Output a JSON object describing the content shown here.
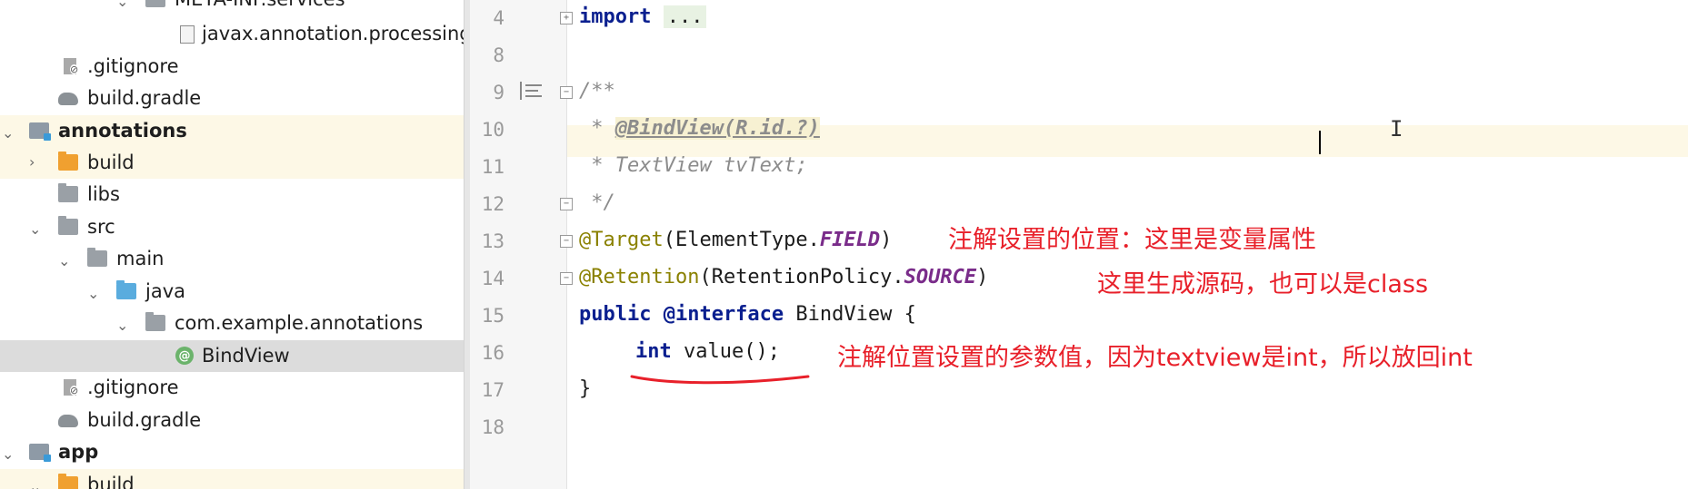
{
  "project_tree": {
    "items": [
      {
        "label": "META-INF.services",
        "icon": "folder-icon"
      },
      {
        "label": "javax.annotation.processing.",
        "icon": "file-icon"
      },
      {
        "label": ".gitignore",
        "icon": "gitignore-icon"
      },
      {
        "label": "build.gradle",
        "icon": "gradle-icon"
      },
      {
        "label": "annotations",
        "icon": "module-icon"
      },
      {
        "label": "build",
        "icon": "folder-icon"
      },
      {
        "label": "libs",
        "icon": "folder-icon"
      },
      {
        "label": "src",
        "icon": "folder-icon"
      },
      {
        "label": "main",
        "icon": "folder-icon"
      },
      {
        "label": "java",
        "icon": "source-folder-icon"
      },
      {
        "label": "com.example.annotations",
        "icon": "package-icon"
      },
      {
        "label": "BindView",
        "icon": "annotation-icon",
        "glyph": "@"
      },
      {
        "label": ".gitignore",
        "icon": "gitignore-icon"
      },
      {
        "label": "build.gradle",
        "icon": "gradle-icon"
      },
      {
        "label": "app",
        "icon": "module-icon"
      },
      {
        "label": "build",
        "icon": "folder-icon"
      }
    ]
  },
  "editor": {
    "line_numbers": [
      "4",
      "8",
      "9",
      "10",
      "11",
      "12",
      "13",
      "14",
      "15",
      "16",
      "17",
      "18"
    ],
    "code": {
      "l4_kw": "import",
      "l4_fold": "...",
      "l9": "/**",
      "l10_star": " * ",
      "l10_tag": "@BindView(R.id.?)",
      "l11": " * TextView tvText;",
      "l12": " */",
      "l13_ann": "@Target",
      "l13_rest": "(ElementType.",
      "l13_field": "FIELD",
      "l13_close": ")",
      "l14_ann": "@Retention",
      "l14_rest": "(RetentionPolicy.",
      "l14_field": "SOURCE",
      "l14_close": ")",
      "l15_kw": "public @interface",
      "l15_rest": " BindView {",
      "l16_kw": "int",
      "l16_rest": " value();",
      "l17": "}"
    },
    "annotations_notes": {
      "note1": "注解设置的位置：这里是变量属性",
      "note2": "这里生成源码，也可以是class",
      "note3": "注解位置设置的参数值，因为textview是int，所以放回int"
    },
    "note_color": "#e8202a"
  }
}
